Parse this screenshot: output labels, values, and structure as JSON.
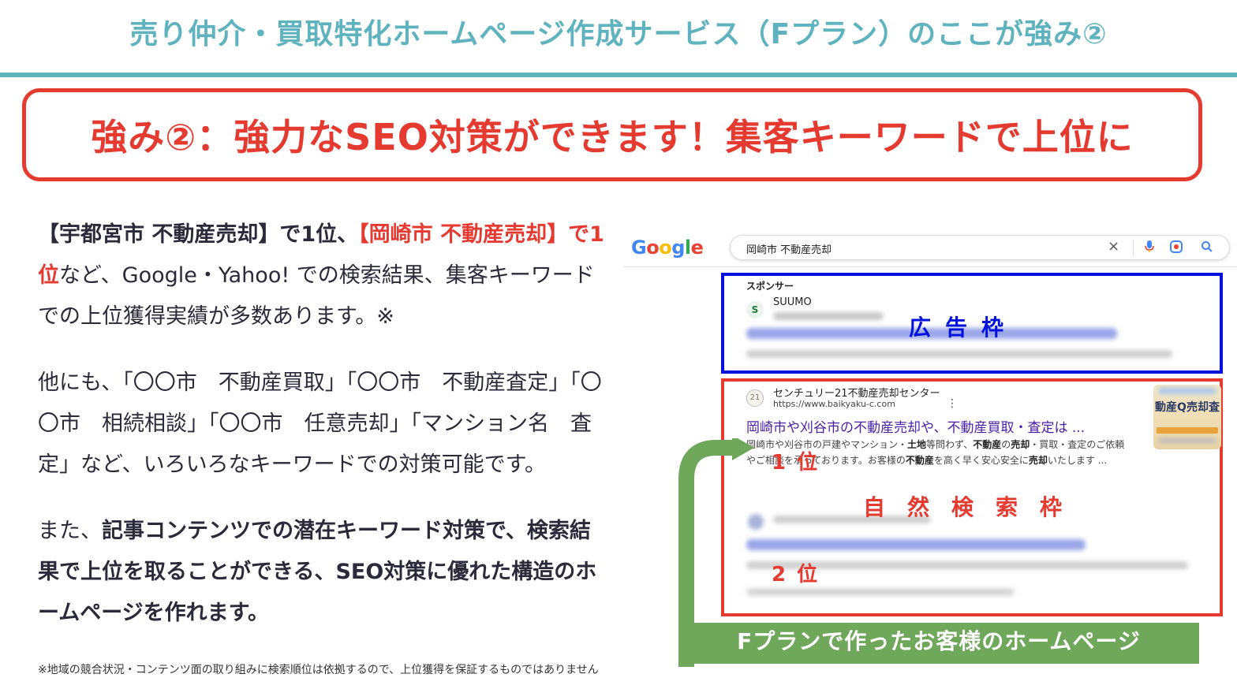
{
  "header": {
    "title": "売り仲介・買取特化ホームページ作成サービス（Fプラン）のここが強み②"
  },
  "headline": {
    "text": "強み②：強力なSEO対策ができます！集客キーワードで上位に"
  },
  "body": {
    "p1": {
      "a": "【宇都宮市 不動産売却】で1位、",
      "b": "【岡崎市 不動産売却】で1位",
      "c": "など、Google・Yahoo! での検索結果、集客キーワードでの上位獲得実績が多数あります。※"
    },
    "p2": "他にも、「〇〇市　不動産買取」「〇〇市　不動産査定」「〇〇市　相続相談」「〇〇市　任意売却」「マンション名　査定」など、いろいろなキーワードでの対策可能です。",
    "p3": {
      "a": "また、",
      "b": "記事コンテンツでの潜在キーワード対策で、検索結果で上位を取ることができる、SEO対策に優れた構造のホームページを作れます。"
    },
    "footnote": "※地域の競合状況・コンテンツ面の取り組みに検索順位は依拠するので、上位獲得を保証するものではありません"
  },
  "serp": {
    "logo": {
      "G": "G",
      "o1": "o",
      "o2": "o",
      "g": "g",
      "l": "l",
      "e": "e"
    },
    "search_value": "岡崎市 不動産売却",
    "icons": {
      "close": "close-icon",
      "mic": "mic-icon",
      "lens": "lens-icon",
      "search": "search-icon"
    },
    "sponsor_label": "スポンサー",
    "ad_site": "SUUMO",
    "ad_logo": "S",
    "ad_label": "広告枠",
    "organic": {
      "logo": "21",
      "site_name": "センチュリー21不動産売却センター",
      "url": "https://www.baikyaku-c.com",
      "title": "岡崎市や刈谷市の不動産売却や、不動産買取・査定は ...",
      "snippet_1": "岡崎市や刈谷市の戸建やマンション・",
      "snippet_b1": "土地",
      "snippet_2": "等問わず、",
      "snippet_b2": "不動産",
      "snippet_3": "の",
      "snippet_b3": "売却",
      "snippet_4": "・買取・査定のご依頼やご相談を承っております。お客様の",
      "snippet_b4": "不動産",
      "snippet_5": "を高く早く安心安全に",
      "snippet_b5": "売却",
      "snippet_6": "いたします ...",
      "thumb_text": "動産Q売却査"
    },
    "rank1": "1位",
    "organic_label": "自然検索枠",
    "rank2": "2位"
  },
  "banner": {
    "text": "Fプランで作ったお客様のホームページ"
  },
  "colors": {
    "teal": "#5fb3bf",
    "red": "#e53a2f",
    "blue": "#0011dd",
    "green": "#6fa85a"
  }
}
